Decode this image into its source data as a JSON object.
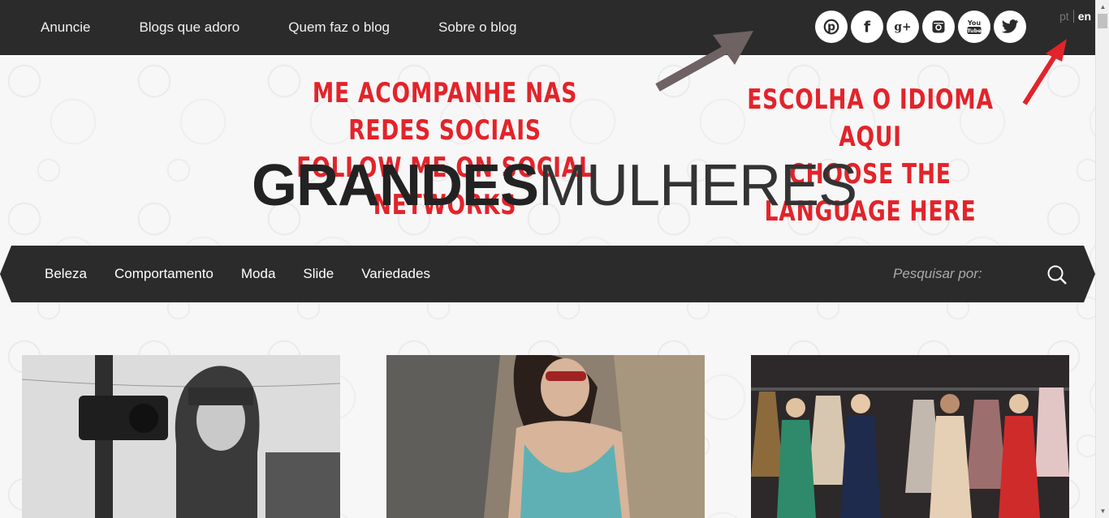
{
  "top_nav": {
    "items": [
      {
        "label": "Anuncie"
      },
      {
        "label": "Blogs que adoro"
      },
      {
        "label": "Quem faz o blog"
      },
      {
        "label": "Sobre o blog"
      }
    ]
  },
  "socials": [
    {
      "icon": "pinterest-icon",
      "glyph": "P"
    },
    {
      "icon": "facebook-icon",
      "glyph": "f"
    },
    {
      "icon": "google-plus-icon",
      "glyph": "g+"
    },
    {
      "icon": "instagram-icon",
      "glyph": "◙"
    },
    {
      "icon": "youtube-icon",
      "glyph": "You"
    },
    {
      "icon": "twitter-icon",
      "glyph": "🐦"
    }
  ],
  "language": {
    "pt": "pt",
    "en": "en",
    "active": "en"
  },
  "annotations": {
    "social_line1": "Me acompanhe nas redes sociais",
    "social_line2": "Follow me on social networks",
    "lang_line1": "Escolha o idioma aqui",
    "lang_line2": "Choose the language here",
    "arrow_color_social": "#6e6262",
    "arrow_color_lang": "#e3232a"
  },
  "logo": {
    "bold": "GRANDES",
    "thin": "MULHERES"
  },
  "category_nav": {
    "items": [
      {
        "label": "Beleza"
      },
      {
        "label": "Comportamento"
      },
      {
        "label": "Moda"
      },
      {
        "label": "Slide"
      },
      {
        "label": "Variedades"
      }
    ],
    "search_placeholder": "Pesquisar por:"
  },
  "colors": {
    "dark_bar": "#2b2b2b",
    "annotation_red": "#e3232a"
  }
}
